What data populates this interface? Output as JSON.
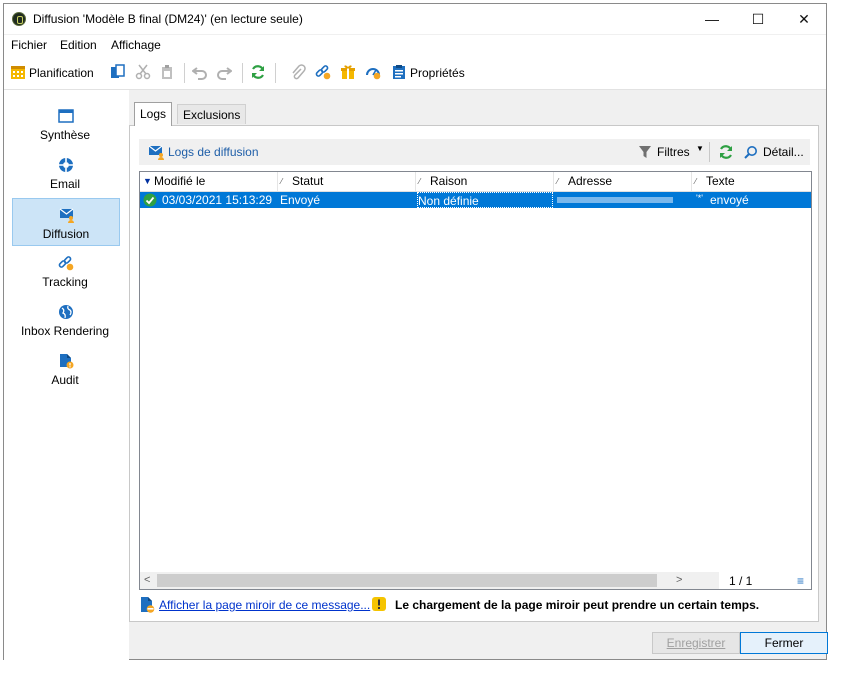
{
  "window": {
    "title": "Diffusion 'Modèle B final (DM24)' (en lecture seule)",
    "minimize": "—",
    "maximize": "☐",
    "close": "✕"
  },
  "menu": [
    "Fichier",
    "Edition",
    "Affichage"
  ],
  "toolbar": {
    "planification": "Planification",
    "proprietes": "Propriétés"
  },
  "sidebar": [
    {
      "label": "Synthèse",
      "icon": "summary-window-icon"
    },
    {
      "label": "Email",
      "icon": "email-lifebuoy-icon"
    },
    {
      "label": "Diffusion",
      "icon": "envelope-person-icon",
      "active": true
    },
    {
      "label": "Tracking",
      "icon": "link-tracking-icon"
    },
    {
      "label": "Inbox Rendering",
      "icon": "globe-icon"
    },
    {
      "label": "Audit",
      "icon": "audit-file-icon"
    }
  ],
  "tabs": [
    "Logs",
    "Exclusions"
  ],
  "logs": {
    "title": "Logs de diffusion",
    "filters": "Filtres",
    "detail": "Détail...",
    "columns": [
      "Modifié le",
      "Statut",
      "Raison",
      "Adresse",
      "Texte"
    ],
    "rows": [
      {
        "date": "03/03/2021 15:13:29",
        "statut": "Envoyé",
        "raison": "Non définie",
        "adresse": "",
        "texte_prefix": "'*'",
        "texte": "envoyé"
      }
    ],
    "pagination": "1 / 1"
  },
  "mirror": {
    "link": "Afficher la page miroir de ce message...",
    "warning": "Le chargement de la page miroir peut prendre un certain temps."
  },
  "buttons": {
    "save": "Enregistrer",
    "close": "Fermer"
  },
  "colors": {
    "selection": "#0078d7",
    "active_side": "#cce4f7",
    "accent_blue": "#1e6fc0",
    "green_ok": "#2ea043"
  }
}
